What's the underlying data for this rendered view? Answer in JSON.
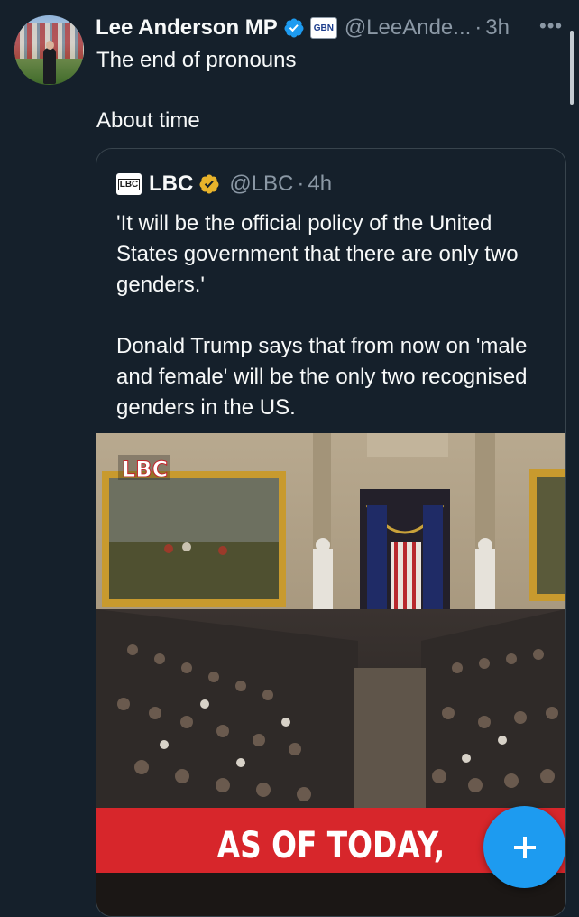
{
  "tweet": {
    "author_name": "Lee Anderson MP",
    "handle": "@LeeAnde...",
    "separator": "·",
    "time": "3h",
    "affiliate_badge": "GBN",
    "more_icon": "more-horizontal-icon",
    "line1": "The end of pronouns",
    "line2": "About time"
  },
  "quote": {
    "logo_text": "LBC",
    "author_name": "LBC",
    "handle": "@LBC",
    "separator": "·",
    "time": "4h",
    "para1": "'It will be the official policy of the United States government that there are only two genders.'",
    "para2": "Donald Trump says that from now on 'male and female' will be the only two recognised genders in the US."
  },
  "media": {
    "watermark": "LBC",
    "caption": "AS OF TODAY,"
  },
  "fab": {
    "icon": "plus-icon"
  },
  "colors": {
    "background": "#15202b",
    "accent": "#1d9bf0",
    "muted": "#8b98a5",
    "border": "#38444d",
    "gold_verified": "#e8b32b",
    "caption_red": "#d7262b"
  }
}
